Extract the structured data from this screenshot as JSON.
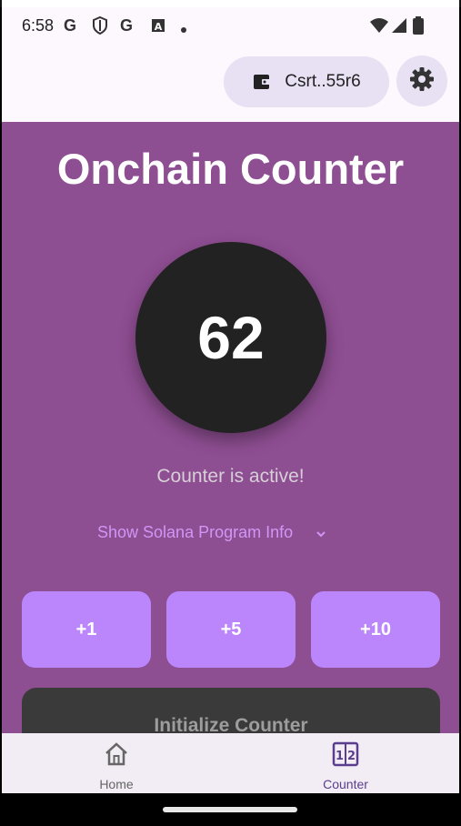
{
  "status_bar": {
    "time": "6:58",
    "icons": [
      "google-g-icon",
      "shield-icon",
      "google-g-icon",
      "app-a-icon",
      "dot-icon"
    ],
    "right_icons": [
      "wifi-icon",
      "signal-icon",
      "battery-icon"
    ]
  },
  "app_bar": {
    "wallet_label": "Csrt..55r6",
    "settings_icon": "gear-icon"
  },
  "main": {
    "title": "Onchain Counter",
    "count": "62",
    "status": "Counter is active!",
    "program_info_label": "Show Solana Program Info",
    "increment_buttons": [
      "+1",
      "+5",
      "+10"
    ],
    "initialize_label": "Initialize Counter"
  },
  "bottom_nav": {
    "items": [
      {
        "label": "Home",
        "icon": "home-icon",
        "selected": false
      },
      {
        "label": "Counter",
        "icon": "counter-icon",
        "selected": true
      }
    ]
  },
  "colors": {
    "main_bg": "#8e4e92",
    "accent": "#bb86fc",
    "circle": "#222222",
    "nav_selected": "#5b3d8f",
    "nav_unselected": "#666666"
  }
}
